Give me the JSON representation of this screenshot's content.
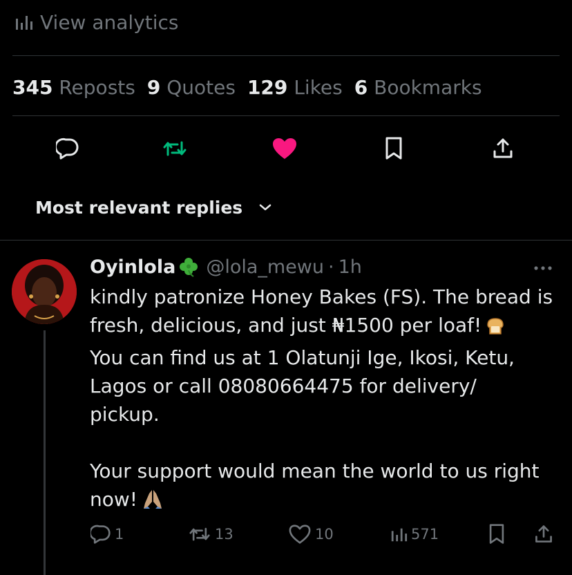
{
  "analytics": {
    "label": "View analytics",
    "icon": "analytics-icon"
  },
  "stats": [
    {
      "num": "345",
      "label": "Reposts"
    },
    {
      "num": "9",
      "label": "Quotes"
    },
    {
      "num": "129",
      "label": "Likes"
    },
    {
      "num": "6",
      "label": "Bookmarks"
    }
  ],
  "post_actions": {
    "icons": [
      "reply-icon",
      "repost-icon",
      "like-icon",
      "bookmark-icon",
      "share-icon"
    ],
    "repost_color": "#00ba7c",
    "like_color": "#f91880"
  },
  "replies_sort": {
    "label": "Most relevant replies"
  },
  "reply": {
    "display_name": "Oyinlola",
    "name_emoji": "🍀",
    "handle": "@lola_mewu",
    "separator": "·",
    "time": "1h",
    "text_para1": "kindly patronize Honey Bakes (FS). The bread is fresh, delicious, and just ₦1500 per loaf!",
    "emoji1": "🍞",
    "text_para2_line1": "You can find us at 1 Olatunji Ige, Ikosi, Ketu, Lagos or call 08080664475 for delivery/",
    "text_para2_line2": "pickup.",
    "text_para3": "Your support would mean the world to us right now!",
    "emoji2": "🙏",
    "counts": {
      "replies": "1",
      "reposts": "13",
      "likes": "10",
      "views": "571"
    }
  },
  "colors": {
    "background": "#000000",
    "text": "#e7e9ea",
    "muted": "#71767b",
    "divider": "#2f3336"
  }
}
